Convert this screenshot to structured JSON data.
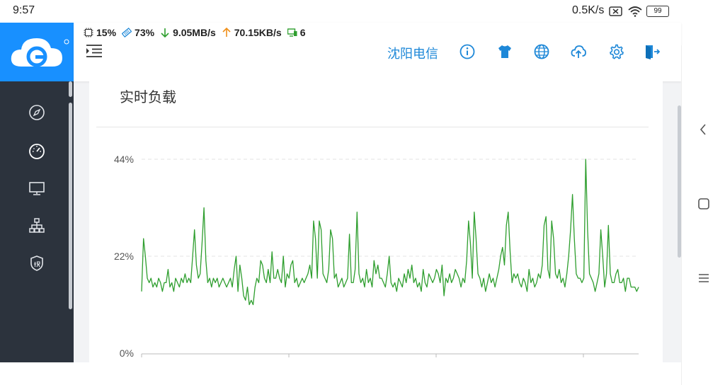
{
  "status_bar": {
    "time": "9:57",
    "speed": "0.5K/s",
    "battery": "99"
  },
  "header": {
    "stats": {
      "cpu": "15%",
      "memory": "73%",
      "download": "9.05MB/s",
      "upload": "70.15KB/s",
      "devices": "6"
    },
    "isp_label": "沈阳电信",
    "icons": [
      "info-icon",
      "theme-shirt-icon",
      "globe-icon",
      "cloud-upload-icon",
      "gear-icon",
      "logout-icon"
    ]
  },
  "sidebar": {
    "items": [
      "compass-icon",
      "dashboard-gauge-icon",
      "monitor-icon",
      "network-icon",
      "shield-icon"
    ]
  },
  "panel": {
    "title": "实时负载"
  },
  "chart_data": {
    "type": "line",
    "title": "实时负载",
    "y_ticks": [
      "44%",
      "22%",
      "0%"
    ],
    "ylim": [
      0,
      44
    ],
    "grid": true,
    "color": "#2e9e2e",
    "series": [
      {
        "values": [
          14,
          26,
          22,
          17,
          16,
          17,
          15,
          16,
          15,
          17,
          16,
          14,
          16,
          16,
          19,
          15,
          16,
          14,
          17,
          16,
          15,
          17,
          16,
          18,
          16,
          17,
          16,
          22,
          28,
          20,
          17,
          18,
          25,
          33,
          21,
          16,
          17,
          15,
          17,
          16,
          17,
          15,
          16,
          17,
          16,
          15,
          16,
          17,
          15,
          19,
          22,
          14,
          20,
          17,
          13,
          12,
          15,
          11,
          12,
          11,
          15,
          17,
          16,
          21,
          20,
          17,
          16,
          19,
          16,
          23,
          17,
          17,
          19,
          17,
          16,
          22,
          15,
          18,
          17,
          20,
          21,
          16,
          17,
          15,
          16,
          17,
          16,
          17,
          18,
          20,
          17,
          30,
          26,
          17,
          30,
          28,
          18,
          17,
          16,
          19,
          28,
          26,
          17,
          18,
          15,
          16,
          17,
          15,
          16,
          17,
          27,
          16,
          16,
          19,
          32,
          18,
          16,
          17,
          15,
          19,
          16,
          17,
          15,
          21,
          18,
          20,
          17,
          17,
          16,
          15,
          18,
          22,
          16,
          15,
          16,
          14,
          17,
          16,
          15,
          18,
          16,
          19,
          17,
          20,
          16,
          17,
          15,
          16,
          14,
          19,
          16,
          15,
          18,
          17,
          16,
          17,
          19,
          18,
          16,
          20,
          13,
          17,
          16,
          18,
          16,
          17,
          19,
          18,
          17,
          15,
          17,
          16,
          21,
          30,
          25,
          17,
          32,
          26,
          18,
          17,
          15,
          17,
          14,
          16,
          18,
          16,
          17,
          15,
          17,
          19,
          22,
          24,
          20,
          29,
          32,
          23,
          16,
          18,
          17,
          18,
          16,
          15,
          17,
          16,
          14,
          19,
          16,
          17,
          15,
          16,
          18,
          17,
          20,
          29,
          31,
          19,
          17,
          30,
          26,
          18,
          17,
          19,
          16,
          17,
          15,
          18,
          22,
          28,
          36,
          26,
          18,
          17,
          17,
          16,
          17,
          44,
          28,
          18,
          17,
          16,
          14,
          16,
          18,
          28,
          22,
          15,
          18,
          29,
          18,
          16,
          16,
          18,
          19,
          16,
          16,
          17,
          14,
          17,
          17,
          15,
          15,
          15,
          14,
          15
        ]
      }
    ]
  }
}
